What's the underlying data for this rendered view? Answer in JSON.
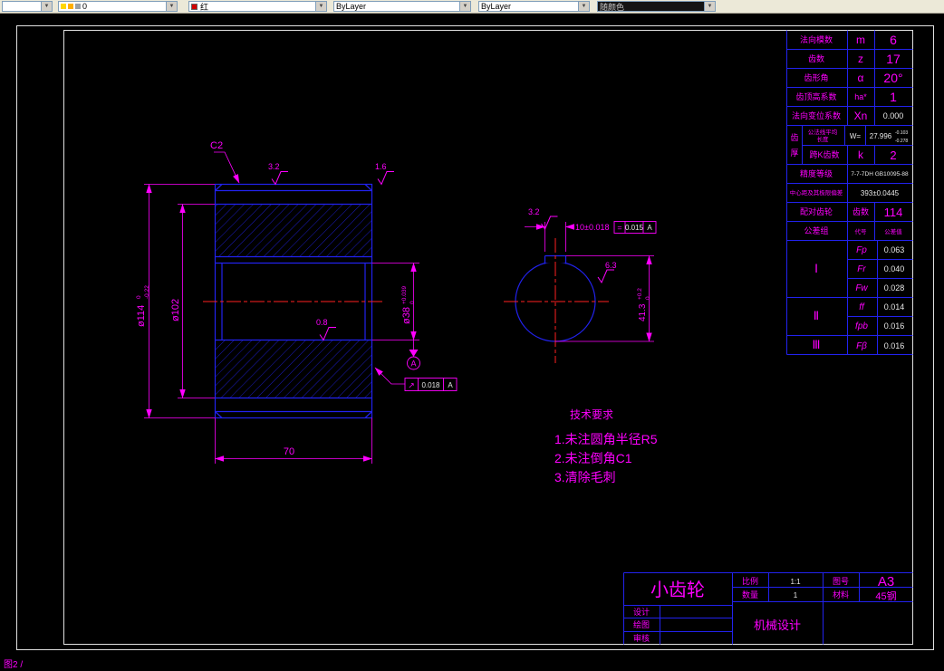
{
  "toolbar": {
    "layer_value": "0",
    "color_value": "红",
    "linetype_value": "ByLayer",
    "lineweight_value": "ByLayer",
    "plotstyle_value": "随颜色"
  },
  "drawing": {
    "chamfer_label": "C2",
    "finish": {
      "top1": "3.2",
      "top2": "1.6",
      "bore": "0.8",
      "key_left": "3.2",
      "key_right": "6.3"
    },
    "dims": {
      "od": {
        "main": "ø114",
        "up": "0",
        "dn": "-0.22"
      },
      "root": {
        "main": "ø102"
      },
      "bore": {
        "main": "ø38",
        "up": "+0.039",
        "dn": "0"
      },
      "width": {
        "main": "70"
      },
      "key_width": {
        "main": "10±0.018"
      },
      "key_height": {
        "main": "41.3",
        "up": "+0.2",
        "dn": "0"
      }
    },
    "gdt1": {
      "sym": "↗",
      "tol": "0.018",
      "datum": "A"
    },
    "gdt2": {
      "sym": "=",
      "tol": "0.015",
      "datum": "A"
    },
    "datum_label": "A",
    "tech": {
      "title": "技术要求",
      "item1": "1.未注圆角半径R5",
      "item2": "2.未注倒角C1",
      "item3": "3.清除毛刺"
    }
  },
  "table": {
    "rows": [
      {
        "label": "法向模数",
        "sym": "m",
        "val": "6"
      },
      {
        "label": "齿数",
        "sym": "z",
        "val": "17"
      },
      {
        "label": "齿形角",
        "sym": "α",
        "val": "20°"
      },
      {
        "label": "齿顶高系数",
        "sym": "ha*",
        "val": "1"
      },
      {
        "label": "法向变位系数",
        "sym": "Xn",
        "val": "0.000"
      }
    ],
    "tooth": {
      "label1": "齿",
      "label2": "厚",
      "w_label1": "公法线平均",
      "w_label2": "长度",
      "w_sym": "W=",
      "w_val": "27.996",
      "w_up": "-0.103",
      "w_dn": "-0.278",
      "k_label": "跨K齿数",
      "k_sym": "k",
      "k_val": "2"
    },
    "accuracy": {
      "label": "精度等级",
      "val": "7-7-7DH GB10095-88"
    },
    "center_dist": {
      "label": "中心距及其极限偏差",
      "val": "393±0.0445"
    },
    "mate": {
      "label": "配对齿轮",
      "sym": "齿数",
      "val": "114"
    },
    "tol_group": {
      "label": "公差组",
      "col2": "代号",
      "col3": "公差值"
    },
    "groups": [
      {
        "name": "Ⅰ"
      },
      {
        "name": "Ⅱ"
      },
      {
        "name": "Ⅲ"
      }
    ],
    "tol_rows": [
      {
        "sym": "Fp",
        "val": "0.063"
      },
      {
        "sym": "Fr",
        "val": "0.040"
      },
      {
        "sym": "Fw",
        "val": "0.028"
      },
      {
        "sym": "ff",
        "val": "0.014"
      },
      {
        "sym": "fpb",
        "val": "0.016"
      },
      {
        "sym": "Fβ",
        "val": "0.016"
      }
    ]
  },
  "titleblock": {
    "part": "小齿轮",
    "scale_label": "比例",
    "scale_val": "1:1",
    "qty_label": "数量",
    "qty_val": "1",
    "dwg_label": "图号",
    "dwg_val": "A3",
    "mat_label": "材料",
    "mat_val": "45钢",
    "design": "设计",
    "draw": "绘图",
    "check": "审核",
    "org": "机械设计"
  },
  "status": {
    "bottom_left": "图2 /"
  }
}
